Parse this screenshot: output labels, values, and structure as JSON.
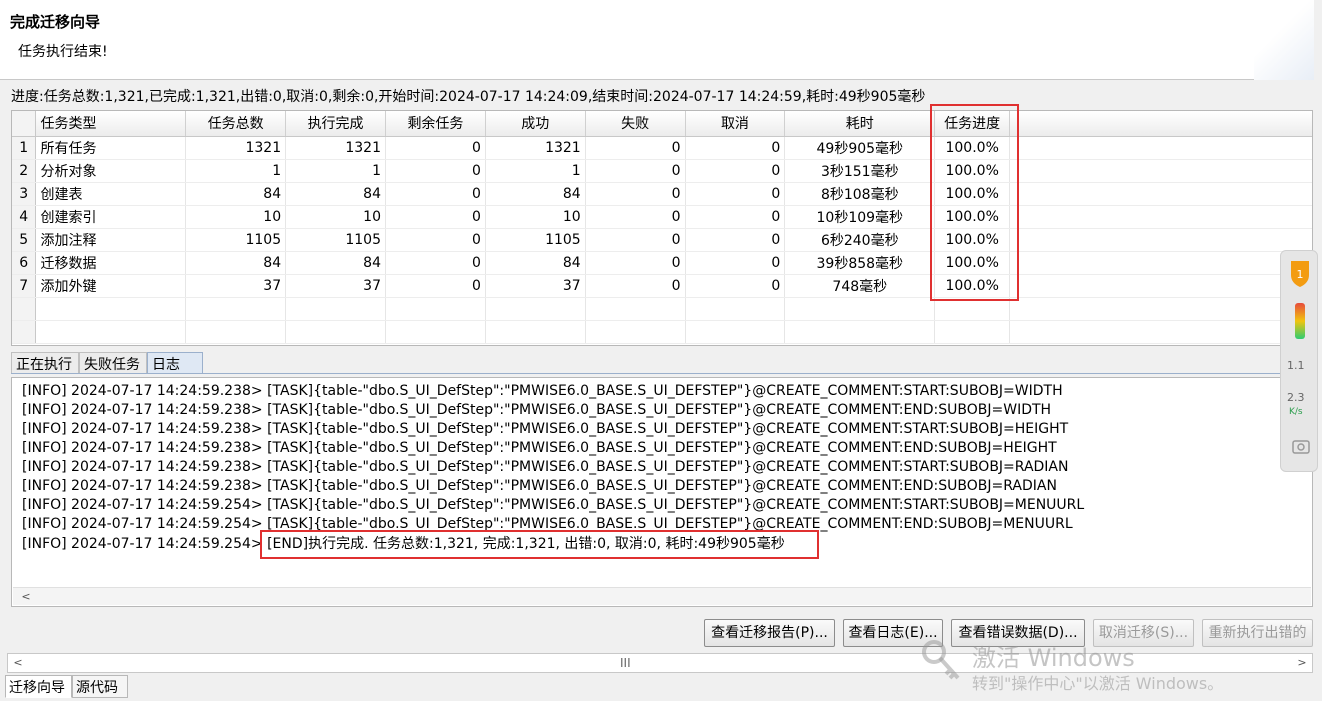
{
  "header": {
    "title": "完成迁移向导",
    "subtitle": "任务执行结束!"
  },
  "progress_text": "进度:任务总数:1,321,已完成:1,321,出错:0,取消:0,剩余:0,开始时间:2024-07-17 14:24:09,结束时间:2024-07-17 14:24:59,耗时:49秒905毫秒",
  "table": {
    "columns": [
      "任务类型",
      "任务总数",
      "执行完成",
      "剩余任务",
      "成功",
      "失败",
      "取消",
      "耗时",
      "任务进度"
    ],
    "rows": [
      {
        "n": "1",
        "type": "所有任务",
        "total": "1321",
        "done": "1321",
        "remain": "0",
        "success": "1321",
        "fail": "0",
        "cancel": "0",
        "time": "49秒905毫秒",
        "progress": "100.0%"
      },
      {
        "n": "2",
        "type": "分析对象",
        "total": "1",
        "done": "1",
        "remain": "0",
        "success": "1",
        "fail": "0",
        "cancel": "0",
        "time": "3秒151毫秒",
        "progress": "100.0%"
      },
      {
        "n": "3",
        "type": "创建表",
        "total": "84",
        "done": "84",
        "remain": "0",
        "success": "84",
        "fail": "0",
        "cancel": "0",
        "time": "8秒108毫秒",
        "progress": "100.0%"
      },
      {
        "n": "4",
        "type": "创建索引",
        "total": "10",
        "done": "10",
        "remain": "0",
        "success": "10",
        "fail": "0",
        "cancel": "0",
        "time": "10秒109毫秒",
        "progress": "100.0%"
      },
      {
        "n": "5",
        "type": "添加注释",
        "total": "1105",
        "done": "1105",
        "remain": "0",
        "success": "1105",
        "fail": "0",
        "cancel": "0",
        "time": "6秒240毫秒",
        "progress": "100.0%"
      },
      {
        "n": "6",
        "type": "迁移数据",
        "total": "84",
        "done": "84",
        "remain": "0",
        "success": "84",
        "fail": "0",
        "cancel": "0",
        "time": "39秒858毫秒",
        "progress": "100.0%"
      },
      {
        "n": "7",
        "type": "添加外键",
        "total": "37",
        "done": "37",
        "remain": "0",
        "success": "37",
        "fail": "0",
        "cancel": "0",
        "time": "748毫秒",
        "progress": "100.0%"
      }
    ]
  },
  "tabs": [
    "正在执行",
    "失败任务",
    "日志"
  ],
  "active_tab": "日志",
  "log_lines": [
    "[INFO] 2024-07-17 14:24:59.238> [TASK]{table-\"dbo.S_UI_DefStep\":\"PMWISE6.0_BASE.S_UI_DEFSTEP\"}@CREATE_COMMENT:START:SUBOBJ=WIDTH",
    "[INFO] 2024-07-17 14:24:59.238> [TASK]{table-\"dbo.S_UI_DefStep\":\"PMWISE6.0_BASE.S_UI_DEFSTEP\"}@CREATE_COMMENT:END:SUBOBJ=WIDTH",
    "[INFO] 2024-07-17 14:24:59.238> [TASK]{table-\"dbo.S_UI_DefStep\":\"PMWISE6.0_BASE.S_UI_DEFSTEP\"}@CREATE_COMMENT:START:SUBOBJ=HEIGHT",
    "[INFO] 2024-07-17 14:24:59.238> [TASK]{table-\"dbo.S_UI_DefStep\":\"PMWISE6.0_BASE.S_UI_DEFSTEP\"}@CREATE_COMMENT:END:SUBOBJ=HEIGHT",
    "[INFO] 2024-07-17 14:24:59.238> [TASK]{table-\"dbo.S_UI_DefStep\":\"PMWISE6.0_BASE.S_UI_DEFSTEP\"}@CREATE_COMMENT:START:SUBOBJ=RADIAN",
    "[INFO] 2024-07-17 14:24:59.238> [TASK]{table-\"dbo.S_UI_DefStep\":\"PMWISE6.0_BASE.S_UI_DEFSTEP\"}@CREATE_COMMENT:END:SUBOBJ=RADIAN",
    "[INFO] 2024-07-17 14:24:59.254> [TASK]{table-\"dbo.S_UI_DefStep\":\"PMWISE6.0_BASE.S_UI_DEFSTEP\"}@CREATE_COMMENT:START:SUBOBJ=MENUURL",
    "[INFO] 2024-07-17 14:24:59.254> [TASK]{table-\"dbo.S_UI_DefStep\":\"PMWISE6.0_BASE.S_UI_DEFSTEP\"}@CREATE_COMMENT:END:SUBOBJ=MENUURL"
  ],
  "log_final": {
    "prefix": "[INFO] 2024-07-17 14:24:59.254>",
    "message": "[END]执行完成. 任务总数:1,321, 完成:1,321, 出错:0, 取消:0, 耗时:49秒905毫秒"
  },
  "buttons": {
    "view_report": "查看迁移报告(P)...",
    "view_log": "查看日志(E)...",
    "view_error_data": "查看错误数据(D)...",
    "cancel_migration": "取消迁移(S)...",
    "rerun_failed": "重新执行出错的"
  },
  "scrollbar_grip": "III",
  "bottom_tabs": [
    "迁移向导",
    "源代码"
  ],
  "watermark": {
    "line1": "激活 Windows",
    "line2": "转到\"操作中心\"以激活 Windows。"
  },
  "side_widget": {
    "badge": "1",
    "up_value": "1.1",
    "down_value": "2.3",
    "unit": "K/s"
  },
  "colors": {
    "highlight": "#e03030",
    "tab_active": "#dfe8f4"
  }
}
